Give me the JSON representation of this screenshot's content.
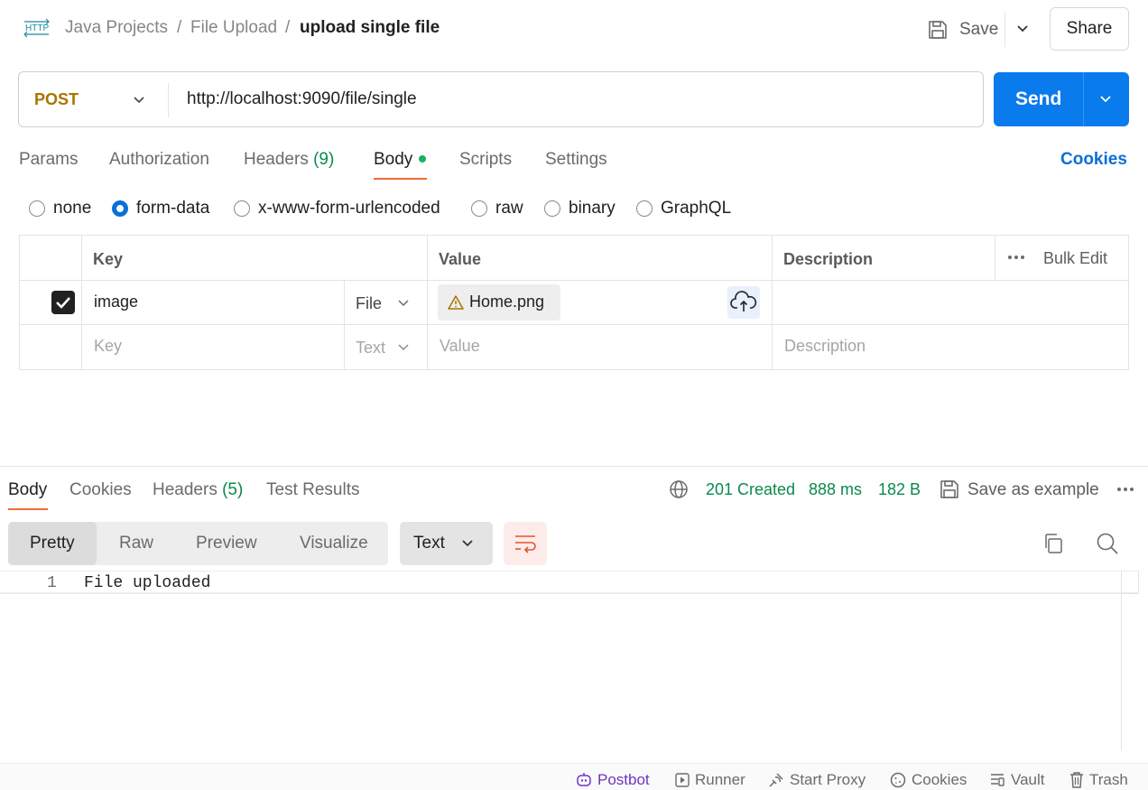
{
  "header": {
    "breadcrumbs": [
      "Java Projects",
      "File Upload",
      "upload single file"
    ],
    "separator": "/",
    "save_label": "Save",
    "share_label": "Share",
    "icons": {
      "request": "http-icon",
      "save": "save-icon",
      "dropdown": "chevron-down-icon"
    }
  },
  "request": {
    "method": "POST",
    "url": "http://localhost:9090/file/single",
    "send_label": "Send",
    "colors": {
      "method": "#a87400",
      "send": "#097bed"
    }
  },
  "request_tabs": {
    "items": [
      {
        "label": "Params"
      },
      {
        "label": "Authorization"
      },
      {
        "label": "Headers",
        "count": "(9)"
      },
      {
        "label": "Body",
        "active": true
      },
      {
        "label": "Scripts"
      },
      {
        "label": "Settings"
      }
    ],
    "cookies_label": "Cookies"
  },
  "body_types": {
    "options": [
      "none",
      "form-data",
      "x-www-form-urlencoded",
      "raw",
      "binary",
      "GraphQL"
    ],
    "selected": "form-data"
  },
  "form_table": {
    "headers": {
      "key": "Key",
      "value": "Value",
      "description": "Description",
      "bulk_edit": "Bulk Edit"
    },
    "rows": [
      {
        "checked": true,
        "key": "image",
        "type": "File",
        "value": "Home.png",
        "description": ""
      }
    ],
    "empty_row": {
      "key": "Key",
      "type": "Text",
      "value": "Value",
      "description": "Description"
    }
  },
  "response": {
    "tabs": [
      {
        "label": "Body",
        "active": true
      },
      {
        "label": "Cookies"
      },
      {
        "label": "Headers",
        "count": "(5)"
      },
      {
        "label": "Test Results"
      }
    ],
    "status": "201 Created",
    "time": "888 ms",
    "size": "182 B",
    "save_example_label": "Save as example",
    "view_modes": [
      "Pretty",
      "Raw",
      "Preview",
      "Visualize"
    ],
    "active_view": "Pretty",
    "format": "Text",
    "lines": [
      {
        "num": "1",
        "text": "File uploaded"
      }
    ],
    "colors": {
      "status": "#0a8a4a",
      "accent": "#f26b3a"
    }
  },
  "footer": {
    "items": [
      "Postbot",
      "Runner",
      "Start Proxy",
      "Cookies",
      "Vault",
      "Trash"
    ]
  }
}
